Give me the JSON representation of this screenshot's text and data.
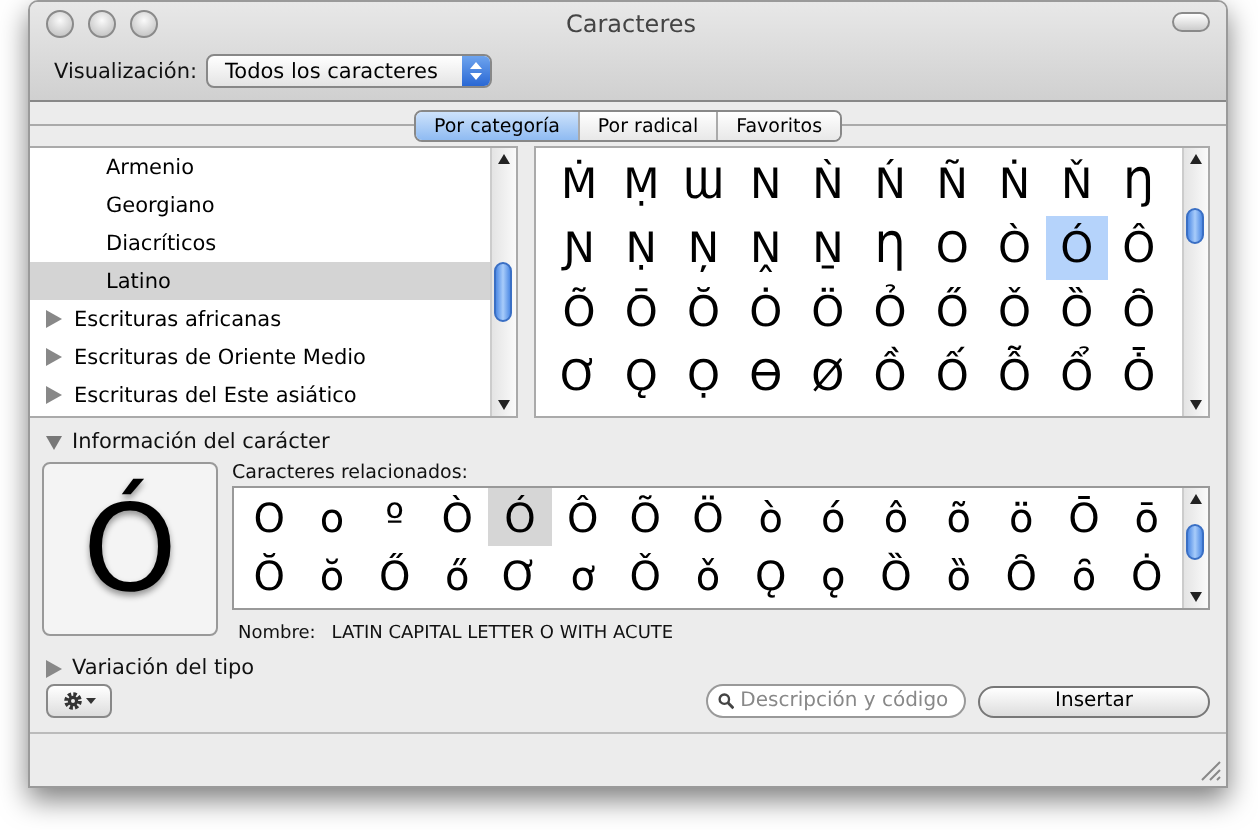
{
  "window": {
    "title": "Caracteres"
  },
  "toolbar": {
    "view_label": "Visualización:",
    "view_value": "Todos los caracteres"
  },
  "tabs": [
    {
      "label": "Por categoría",
      "selected": true
    },
    {
      "label": "Por radical",
      "selected": false
    },
    {
      "label": "Favoritos",
      "selected": false
    }
  ],
  "sidebar": {
    "children": [
      {
        "label": "Armenio",
        "selected": false
      },
      {
        "label": "Georgiano",
        "selected": false
      },
      {
        "label": "Diacríticos",
        "selected": false
      },
      {
        "label": "Latino",
        "selected": true
      }
    ],
    "groups": [
      {
        "label": "Escrituras africanas",
        "expanded": false
      },
      {
        "label": "Escrituras de Oriente Medio",
        "expanded": false
      },
      {
        "label": "Escrituras del Este asiático",
        "expanded": false
      }
    ]
  },
  "character_grid": [
    {
      "char": "Ṁ",
      "selected": false
    },
    {
      "char": "Ṃ",
      "selected": false
    },
    {
      "char": "Ɯ",
      "selected": false
    },
    {
      "char": "N",
      "selected": false
    },
    {
      "char": "Ǹ",
      "selected": false
    },
    {
      "char": "Ń",
      "selected": false
    },
    {
      "char": "Ñ",
      "selected": false
    },
    {
      "char": "Ṅ",
      "selected": false
    },
    {
      "char": "Ň",
      "selected": false
    },
    {
      "char": "Ŋ",
      "selected": false
    },
    {
      "char": "Ɲ",
      "selected": false
    },
    {
      "char": "Ṇ",
      "selected": false
    },
    {
      "char": "Ņ",
      "selected": false
    },
    {
      "char": "Ṋ",
      "selected": false
    },
    {
      "char": "Ṉ",
      "selected": false
    },
    {
      "char": "Ƞ",
      "selected": false
    },
    {
      "char": "O",
      "selected": false
    },
    {
      "char": "Ò",
      "selected": false
    },
    {
      "char": "Ó",
      "selected": true
    },
    {
      "char": "Ô",
      "selected": false
    },
    {
      "char": "Õ",
      "selected": false
    },
    {
      "char": "Ō",
      "selected": false
    },
    {
      "char": "Ŏ",
      "selected": false
    },
    {
      "char": "Ȯ",
      "selected": false
    },
    {
      "char": "Ö",
      "selected": false
    },
    {
      "char": "Ỏ",
      "selected": false
    },
    {
      "char": "Ő",
      "selected": false
    },
    {
      "char": "Ǒ",
      "selected": false
    },
    {
      "char": "Ȍ",
      "selected": false
    },
    {
      "char": "Ȏ",
      "selected": false
    },
    {
      "char": "Ơ",
      "selected": false
    },
    {
      "char": "Ǫ",
      "selected": false
    },
    {
      "char": "Ọ",
      "selected": false
    },
    {
      "char": "Ɵ",
      "selected": false
    },
    {
      "char": "Ø",
      "selected": false
    },
    {
      "char": "Ồ",
      "selected": false
    },
    {
      "char": "Ố",
      "selected": false
    },
    {
      "char": "Ỗ",
      "selected": false
    },
    {
      "char": "Ổ",
      "selected": false
    },
    {
      "char": "Ȱ",
      "selected": false
    }
  ],
  "info": {
    "heading": "Información del carácter",
    "expanded": true,
    "preview": "Ó",
    "related_label": "Caracteres relacionados:",
    "related": [
      {
        "char": "O",
        "selected": false
      },
      {
        "char": "o",
        "selected": false
      },
      {
        "char": "º",
        "selected": false
      },
      {
        "char": "Ò",
        "selected": false
      },
      {
        "char": "Ó",
        "selected": true
      },
      {
        "char": "Ô",
        "selected": false
      },
      {
        "char": "Õ",
        "selected": false
      },
      {
        "char": "Ö",
        "selected": false
      },
      {
        "char": "ò",
        "selected": false
      },
      {
        "char": "ó",
        "selected": false
      },
      {
        "char": "ô",
        "selected": false
      },
      {
        "char": "õ",
        "selected": false
      },
      {
        "char": "ö",
        "selected": false
      },
      {
        "char": "Ō",
        "selected": false
      },
      {
        "char": "ō",
        "selected": false
      },
      {
        "char": "Ŏ",
        "selected": false
      },
      {
        "char": "ŏ",
        "selected": false
      },
      {
        "char": "Ő",
        "selected": false
      },
      {
        "char": "ő",
        "selected": false
      },
      {
        "char": "Ơ",
        "selected": false
      },
      {
        "char": "ơ",
        "selected": false
      },
      {
        "char": "Ǒ",
        "selected": false
      },
      {
        "char": "ǒ",
        "selected": false
      },
      {
        "char": "Ǫ",
        "selected": false
      },
      {
        "char": "ǫ",
        "selected": false
      },
      {
        "char": "Ȍ",
        "selected": false
      },
      {
        "char": "ȍ",
        "selected": false
      },
      {
        "char": "Ȏ",
        "selected": false
      },
      {
        "char": "ȏ",
        "selected": false
      },
      {
        "char": "Ȯ",
        "selected": false
      }
    ],
    "name_label": "Nombre:",
    "name_value": "LATIN CAPITAL LETTER O WITH ACUTE"
  },
  "variation": {
    "heading": "Variación del tipo",
    "expanded": false
  },
  "search": {
    "placeholder": "Descripción y código"
  },
  "buttons": [
    {
      "label": "Insertar"
    }
  ]
}
